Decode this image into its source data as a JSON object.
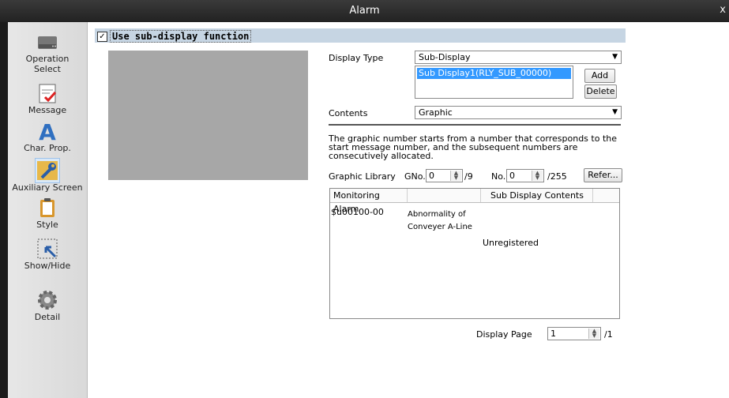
{
  "window": {
    "title": "Alarm",
    "close_label": "x"
  },
  "sidebar": {
    "items": [
      {
        "label": "Operation\nSelect",
        "icon": "drive-icon"
      },
      {
        "label": "Message",
        "icon": "checklist-icon"
      },
      {
        "label": "Char. Prop.",
        "icon": "letter-a-icon"
      },
      {
        "label": "Auxiliary Screen",
        "icon": "wrench-icon"
      },
      {
        "label": "Style",
        "icon": "clipboard-icon"
      },
      {
        "label": "Show/Hide",
        "icon": "cursor-selection-icon"
      },
      {
        "label": "Detail",
        "icon": "gear-icon"
      }
    ]
  },
  "main": {
    "use_sub_display": {
      "checked": true,
      "check_mark": "✓",
      "label": "Use sub-display function"
    },
    "display_type": {
      "label": "Display Type",
      "value": "Sub-Display",
      "list_item": "Sub Display1(RLY_SUB_00000)",
      "add_label": "Add",
      "delete_label": "Delete"
    },
    "contents": {
      "label": "Contents",
      "value": "Graphic"
    },
    "description": "The graphic number starts from a number that corresponds to the start message number, and the subsequent numbers are consecutively allocated.",
    "graphic_library": {
      "label": "Graphic Library",
      "gno_label": "GNo.",
      "gno_value": "0",
      "gno_max": "/9",
      "no_label": "No.",
      "no_value": "0",
      "no_max": "/255",
      "refer_label": "Refer..."
    },
    "table": {
      "headers": [
        "Monitoring Alarm",
        "Sub Display Contents"
      ],
      "rows": [
        {
          "alarm": "$u00100-00",
          "alarm_text_1": "Abnormality of",
          "alarm_text_2": "Conveyer A-Line",
          "contents": "Unregistered"
        }
      ]
    },
    "display_page": {
      "label": "Display Page",
      "value": "1",
      "max": "/1"
    }
  }
}
